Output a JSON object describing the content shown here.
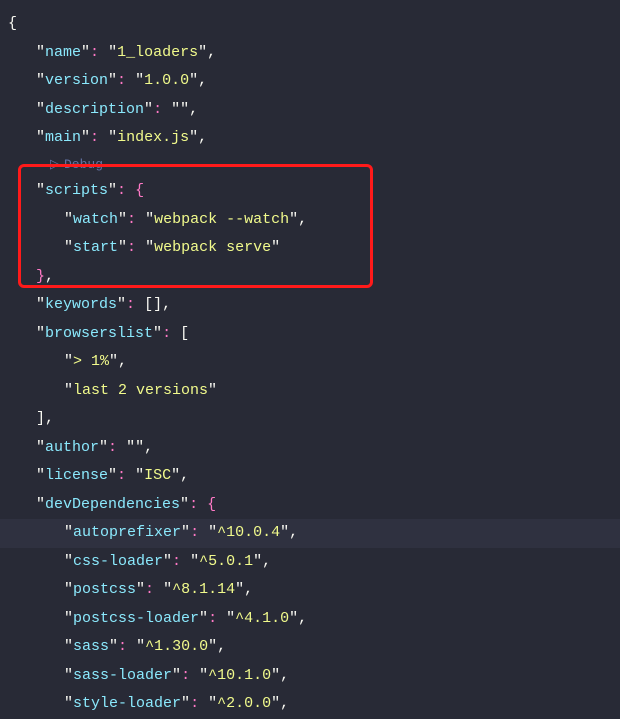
{
  "pkg": {
    "name": "1_loaders",
    "version": "1.0.0",
    "description": "",
    "main": "index.js",
    "scripts": {
      "watch": "webpack --watch",
      "start": "webpack serve"
    },
    "browserslist": [
      "> 1%",
      "last 2 versions"
    ],
    "author": "",
    "license": "ISC",
    "devDependencies": {
      "autoprefixer": "^10.0.4",
      "css-loader": "^5.0.1",
      "postcss": "^8.1.14",
      "postcss-loader": "^4.1.0",
      "sass": "^1.30.0",
      "sass-loader": "^10.1.0",
      "style-loader": "^2.0.0"
    }
  },
  "keys": {
    "name": "name",
    "version": "version",
    "description": "description",
    "main": "main",
    "scripts": "scripts",
    "watch": "watch",
    "start": "start",
    "keywords": "keywords",
    "browserslist": "browserslist",
    "author": "author",
    "license": "license",
    "devDependencies": "devDependencies",
    "autoprefixer": "autoprefixer",
    "cssloader": "css-loader",
    "postcss": "postcss",
    "postcssloader": "postcss-loader",
    "sass": "sass",
    "sassloader": "sass-loader",
    "styleloader": "style-loader"
  },
  "debugLabel": "Debug"
}
